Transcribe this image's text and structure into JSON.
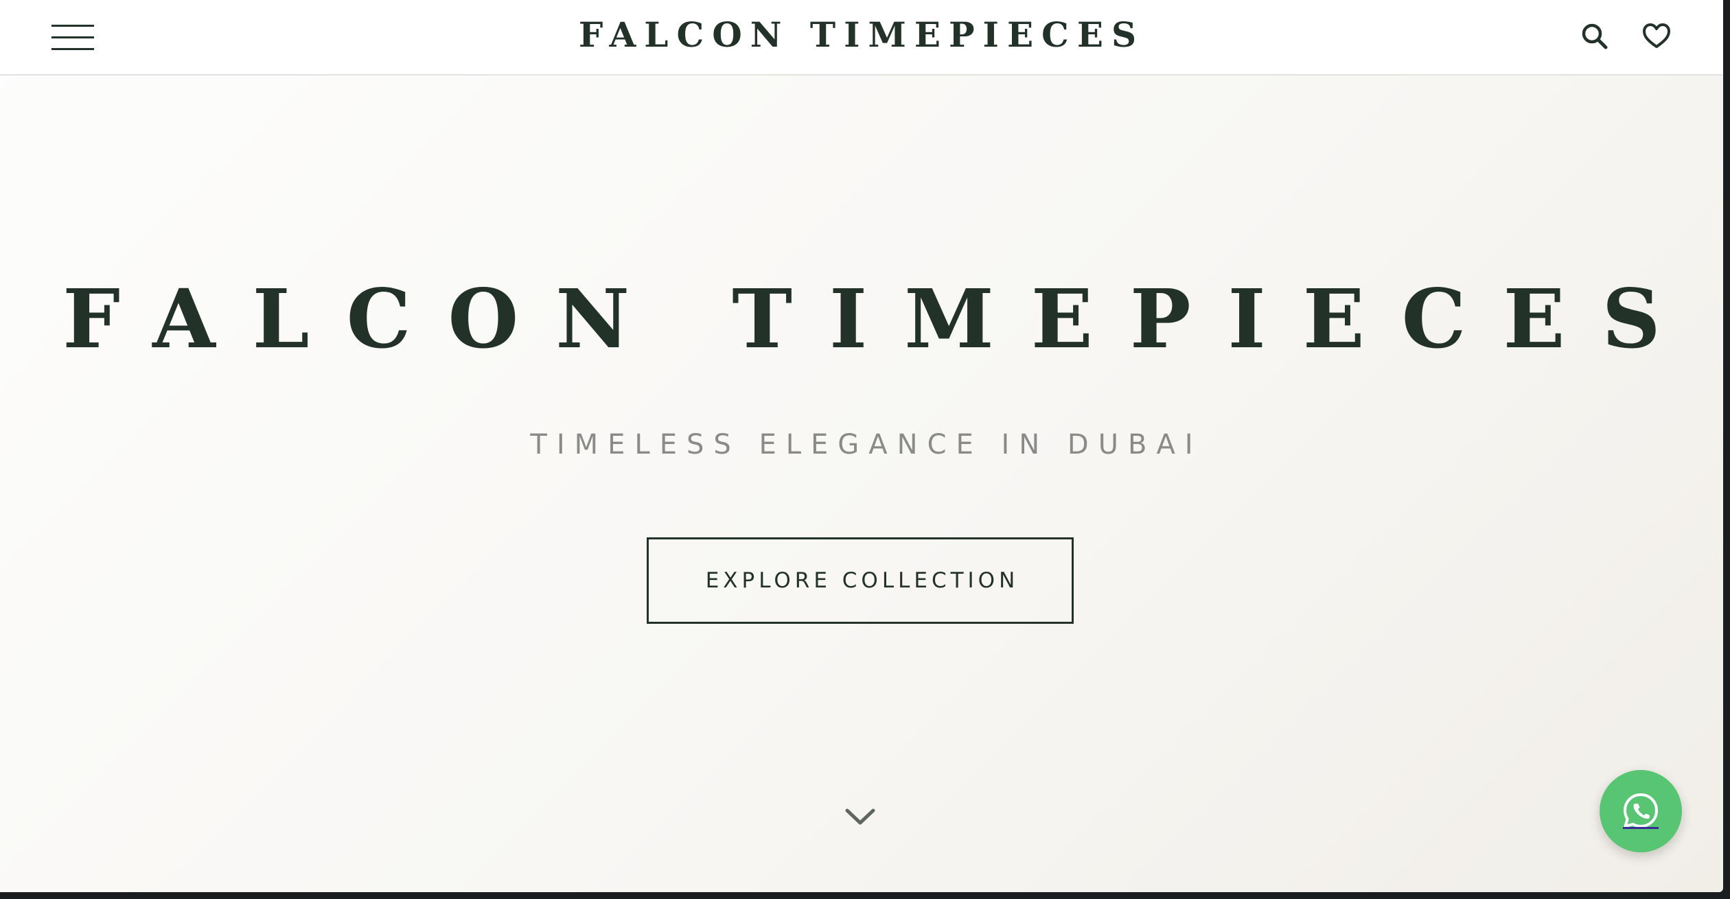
{
  "header": {
    "title": "FALCON TIMEPIECES",
    "menu_icon": "hamburger-menu-icon",
    "search_icon": "search-icon",
    "wishlist_icon": "heart-icon"
  },
  "hero": {
    "title": "FALCON TIMEPIECES",
    "subtitle": "TIMELESS ELEGANCE IN DUBAI",
    "cta_label": "EXPLORE COLLECTION",
    "scroll_icon": "chevron-down-icon"
  },
  "floating": {
    "whatsapp_icon": "whatsapp-icon"
  },
  "colors": {
    "brand": "#223229",
    "subtitle": "#8a8a88",
    "whatsapp": "#58c573",
    "background": "#f8f7f4"
  }
}
